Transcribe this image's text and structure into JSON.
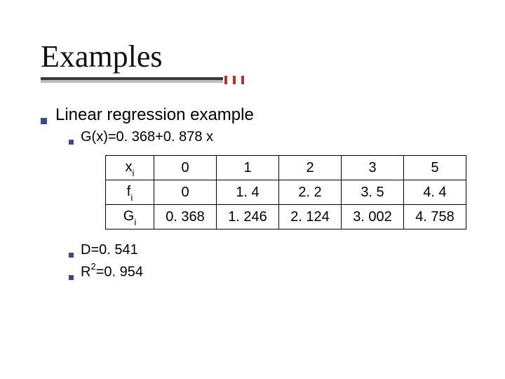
{
  "title": "Examples",
  "bullet_main": "Linear regression example",
  "equation": "G(x)=0. 368+0. 878 x",
  "d_line": "D=0. 541",
  "r2_label_prefix": "R",
  "r2_exp": "2",
  "r2_rest": "=0. 954",
  "row_labels": {
    "xi_base": "x",
    "xi_sub": "i",
    "fi_base": "f",
    "fi_sub": "i",
    "gi_base": "G",
    "gi_sub": "i"
  },
  "chart_data": {
    "type": "table",
    "title": "Linear regression example",
    "columns": [
      "xi",
      "fi",
      "Gi"
    ],
    "x": [
      "0",
      "1",
      "2",
      "3",
      "5"
    ],
    "f": [
      "0",
      "1. 4",
      "2. 2",
      "3. 5",
      "4. 4"
    ],
    "g": [
      "0. 368",
      "1. 246",
      "2. 124",
      "3. 002",
      "4. 758"
    ],
    "regression": {
      "intercept": 0.368,
      "slope": 0.878
    },
    "D": 0.541,
    "R2": 0.954
  }
}
